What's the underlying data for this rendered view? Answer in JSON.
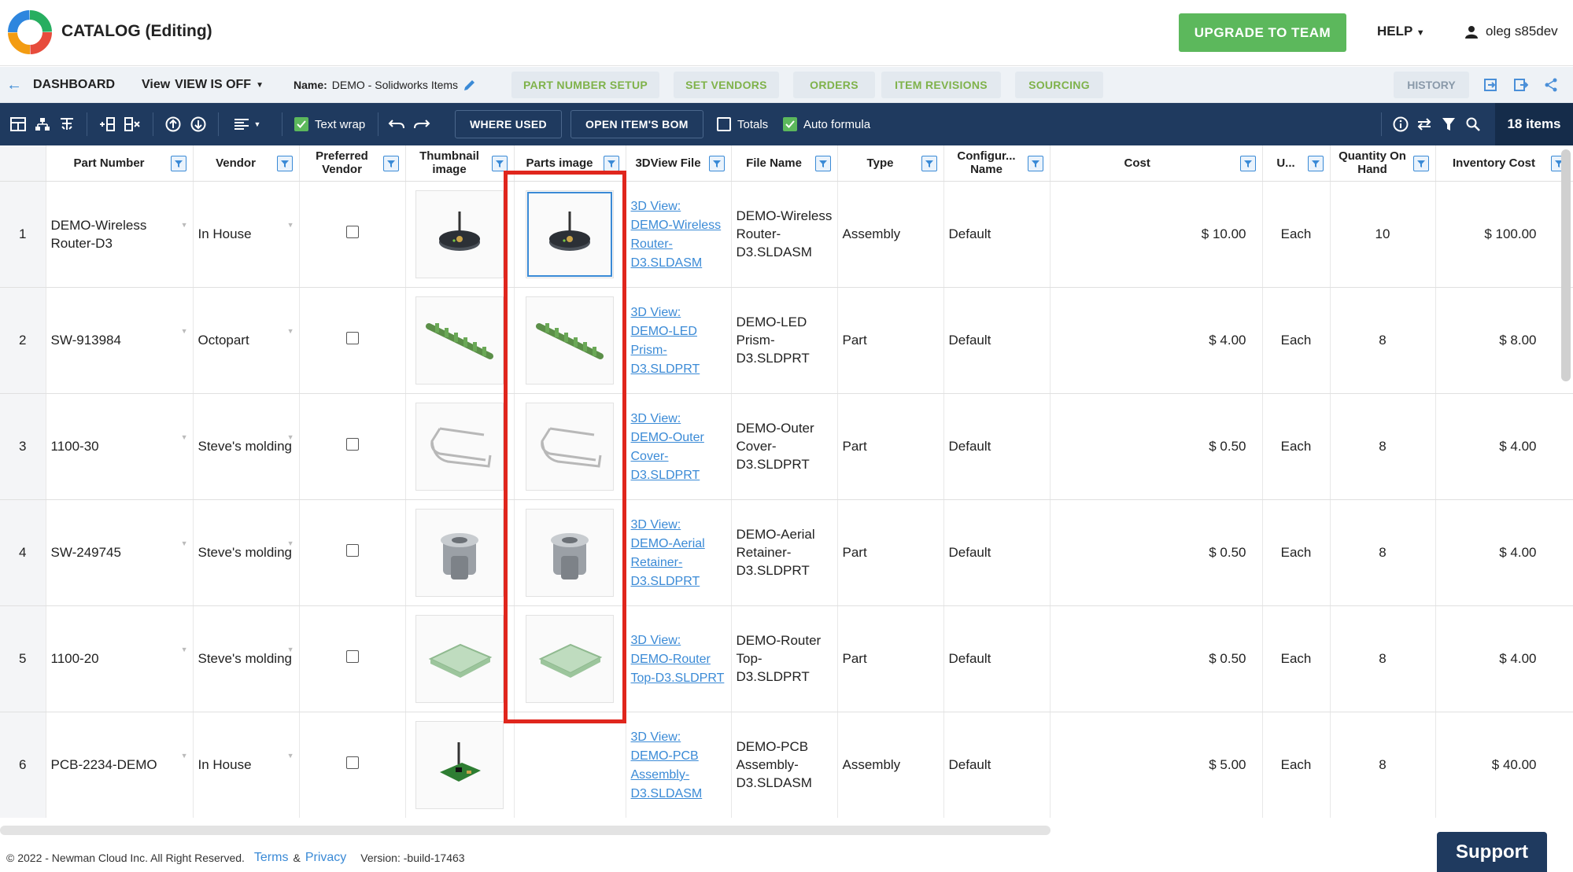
{
  "header": {
    "title": "CATALOG (Editing)",
    "upgrade_label": "UPGRADE TO TEAM",
    "help_label": "HELP",
    "user_name": "oleg s85dev"
  },
  "nav": {
    "dashboard_label": "DASHBOARD",
    "view_prefix": "View",
    "view_value": "VIEW IS OFF",
    "name_prefix": "Name:",
    "name_value": "DEMO - Solidworks Items",
    "tabs": [
      "PART NUMBER SETUP",
      "SET VENDORS",
      "ORDERS",
      "ITEM REVISIONS",
      "SOURCING"
    ],
    "history_label": "HISTORY"
  },
  "toolbar": {
    "text_wrap_label": "Text wrap",
    "where_used_label": "WHERE USED",
    "open_bom_label": "OPEN ITEM'S BOM",
    "totals_label": "Totals",
    "auto_formula_label": "Auto formula",
    "items_count": "18 items"
  },
  "columns": [
    "Part Number",
    "Vendor",
    "Preferred Vendor",
    "Thumbnail image",
    "Parts image",
    "3DView File",
    "File Name",
    "Type",
    "Configur... Name",
    "Cost",
    "U...",
    "Quantity On Hand",
    "Inventory Cost"
  ],
  "rows": [
    {
      "num": "1",
      "part": "DEMO-Wireless Router-D3",
      "vendor": "In House",
      "link": "3D View: DEMO-Wireless Router-D3.SLDASM",
      "file": "DEMO-Wireless Router-D3.SLDASM",
      "type": "Assembly",
      "config": "Default",
      "cost": "$ 10.00",
      "unit": "Each",
      "qty": "10",
      "inv": "$ 100.00",
      "shape": "router"
    },
    {
      "num": "2",
      "part": "SW-913984",
      "vendor": "Octopart",
      "link": "3D View: DEMO-LED Prism-D3.SLDPRT",
      "file": "DEMO-LED Prism-D3.SLDPRT",
      "type": "Part",
      "config": "Default",
      "cost": "$ 4.00",
      "unit": "Each",
      "qty": "8",
      "inv": "$ 8.00",
      "shape": "led"
    },
    {
      "num": "3",
      "part": "1100-30",
      "vendor": "Steve's molding",
      "link": "3D View: DEMO-Outer Cover-D3.SLDPRT",
      "file": "DEMO-Outer Cover-D3.SLDPRT",
      "type": "Part",
      "config": "Default",
      "cost": "$ 0.50",
      "unit": "Each",
      "qty": "8",
      "inv": "$ 4.00",
      "shape": "cover"
    },
    {
      "num": "4",
      "part": "SW-249745",
      "vendor": "Steve's molding",
      "link": "3D View: DEMO-Aerial Retainer-D3.SLDPRT",
      "file": "DEMO-Aerial Retainer-D3.SLDPRT",
      "type": "Part",
      "config": "Default",
      "cost": "$ 0.50",
      "unit": "Each",
      "qty": "8",
      "inv": "$ 4.00",
      "shape": "retainer"
    },
    {
      "num": "5",
      "part": "1100-20",
      "vendor": "Steve's molding",
      "link": "3D View: DEMO-Router Top-D3.SLDPRT",
      "file": "DEMO-Router Top-D3.SLDPRT",
      "type": "Part",
      "config": "Default",
      "cost": "$ 0.50",
      "unit": "Each",
      "qty": "8",
      "inv": "$ 4.00",
      "shape": "top"
    },
    {
      "num": "6",
      "part": "PCB-2234-DEMO",
      "vendor": "In House",
      "link": "3D View: DEMO-PCB Assembly-D3.SLDASM",
      "file": "DEMO-PCB Assembly-D3.SLDASM",
      "type": "Assembly",
      "config": "Default",
      "cost": "$ 5.00",
      "unit": "Each",
      "qty": "8",
      "inv": "$ 40.00",
      "shape": "pcb"
    }
  ],
  "footer": {
    "copyright": "© 2022 - Newman Cloud Inc. All Right Reserved.",
    "terms": "Terms",
    "amp": "&",
    "privacy": "Privacy",
    "version": "Version: -build-17463"
  },
  "support_label": "Support",
  "colors": {
    "accent": "#5cb85c",
    "toolbar": "#1f3a5f",
    "link": "#3a8ad6",
    "highlight": "#e0261d"
  }
}
